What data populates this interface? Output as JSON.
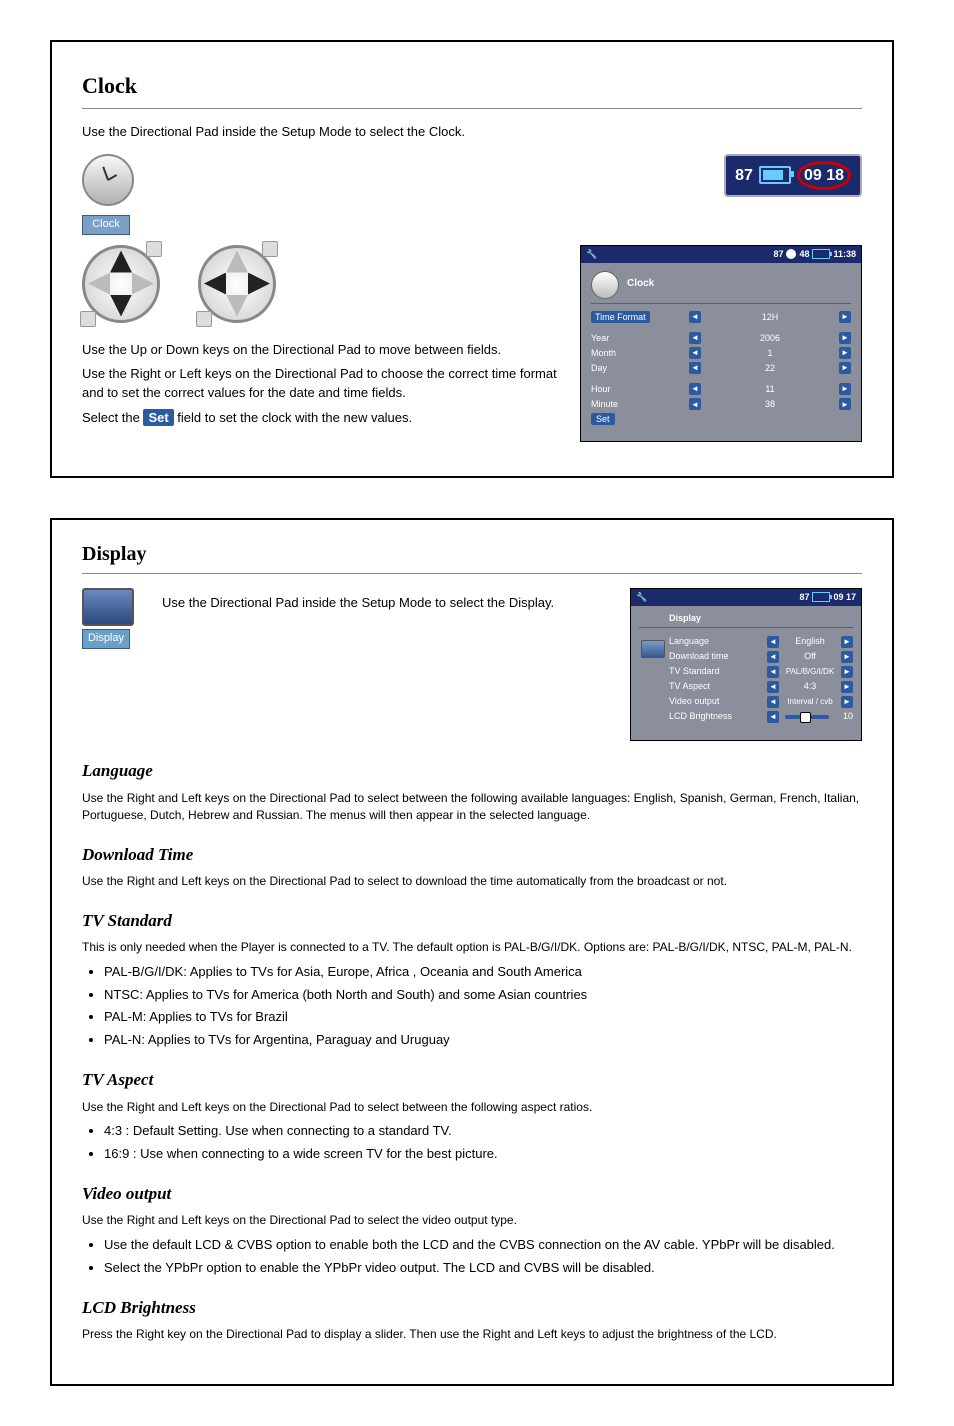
{
  "top": {
    "title": "Clock",
    "intro": "Use the Directional Pad inside the Setup Mode to select the Clock.",
    "dpad_desc1": "Use the Up or Down keys on the Directional Pad to move between fields.",
    "dpad_desc2": "Use the Right or Left keys on the Directional Pad to choose the correct time format and to set the correct values for the date and time fields.",
    "set_line_pre": "Select the ",
    "set_word": "Set",
    "set_line_post": " field to set the clock with the new values.",
    "clock_label": "Clock",
    "status_87": "87",
    "status_time": "09 18",
    "osd": {
      "bar_87": "87",
      "bar_48": "48",
      "bar_time": "11:38",
      "header": "Clock",
      "rows": {
        "fmt_l": "Time Format",
        "fmt_v": "12H",
        "year_l": "Year",
        "year_v": "2006",
        "mon_l": "Month",
        "mon_v": "1",
        "day_l": "Day",
        "day_v": "22",
        "hr_l": "Hour",
        "hr_v": "11",
        "min_l": "Minute",
        "min_v": "38",
        "set_l": "Set"
      }
    }
  },
  "bottom": {
    "title": "Display",
    "intro": "Use the Directional Pad inside the Setup Mode to select the Display.",
    "disp_label": "Display",
    "osd": {
      "bar_87": "87",
      "bar_time": "09 17",
      "header": "Display",
      "rows": {
        "lang_l": "Language",
        "lang_v": "English",
        "dl_l": "Download time",
        "dl_v": "Off",
        "tv_l": "TV Standard",
        "tv_v": "PAL/B/G/I/DK",
        "asp_l": "TV Aspect",
        "asp_v": "4:3",
        "vo_l": "Video output",
        "vo_v": "Interval / cvb",
        "bri_l": "LCD Brightness",
        "bri_v": "10"
      }
    },
    "items": {
      "lang": {
        "h": "Language",
        "d": "Use the Right and Left keys on the Directional Pad to select between the following available languages: English, Spanish, German, French, Italian, Portuguese, Dutch, Hebrew and Russian. The menus will then appear in the selected language."
      },
      "dl": {
        "h": "Download Time",
        "d": "Use the Right and Left keys on the Directional Pad to select to download the time automatically from the broadcast or not."
      },
      "tv": {
        "h": "TV Standard",
        "pre": "This is only needed when the Player is connected to a TV. The default option is PAL-B/G/I/DK. Options are: PAL-B/G/I/DK, NTSC, PAL-M, PAL-N.",
        "b1l": "PAL-B/G/I/DK:",
        "b1d": "Applies to TVs for Asia, Europe, Africa , Oceania and South America",
        "b2l": "NTSC:",
        "b2d": "Applies to TVs for America (both North and South) and some Asian countries",
        "b3l": "PAL-M:",
        "b3d": "Applies to TVs for Brazil",
        "b4l": "PAL-N:",
        "b4d": "Applies to TVs for Argentina, Paraguay and Uruguay"
      },
      "asp": {
        "h": "TV Aspect",
        "d": "Use the Right and Left keys on the Directional Pad to select between the following aspect ratios.",
        "a1l": "4:3 :",
        "a1d": "Default Setting. Use when connecting to a standard TV.",
        "a2l": "16:9 :",
        "a2d": "Use when connecting to a wide screen TV for the best picture."
      },
      "vo": {
        "h": "Video output",
        "d": "Use the Right and Left keys on the Directional Pad to select the video output type.",
        "o1d": "Use the default LCD & CVBS option to enable both the LCD and the CVBS connection on the AV cable. YPbPr will be disabled.",
        "o2d": "Select the YPbPr option to enable the YPbPr video output. The LCD and CVBS will be disabled."
      },
      "bri": {
        "h": "LCD Brightness",
        "d": "Press the Right key on the Directional Pad to display a slider. Then use the Right and Left keys to adjust the brightness of the LCD."
      }
    }
  }
}
